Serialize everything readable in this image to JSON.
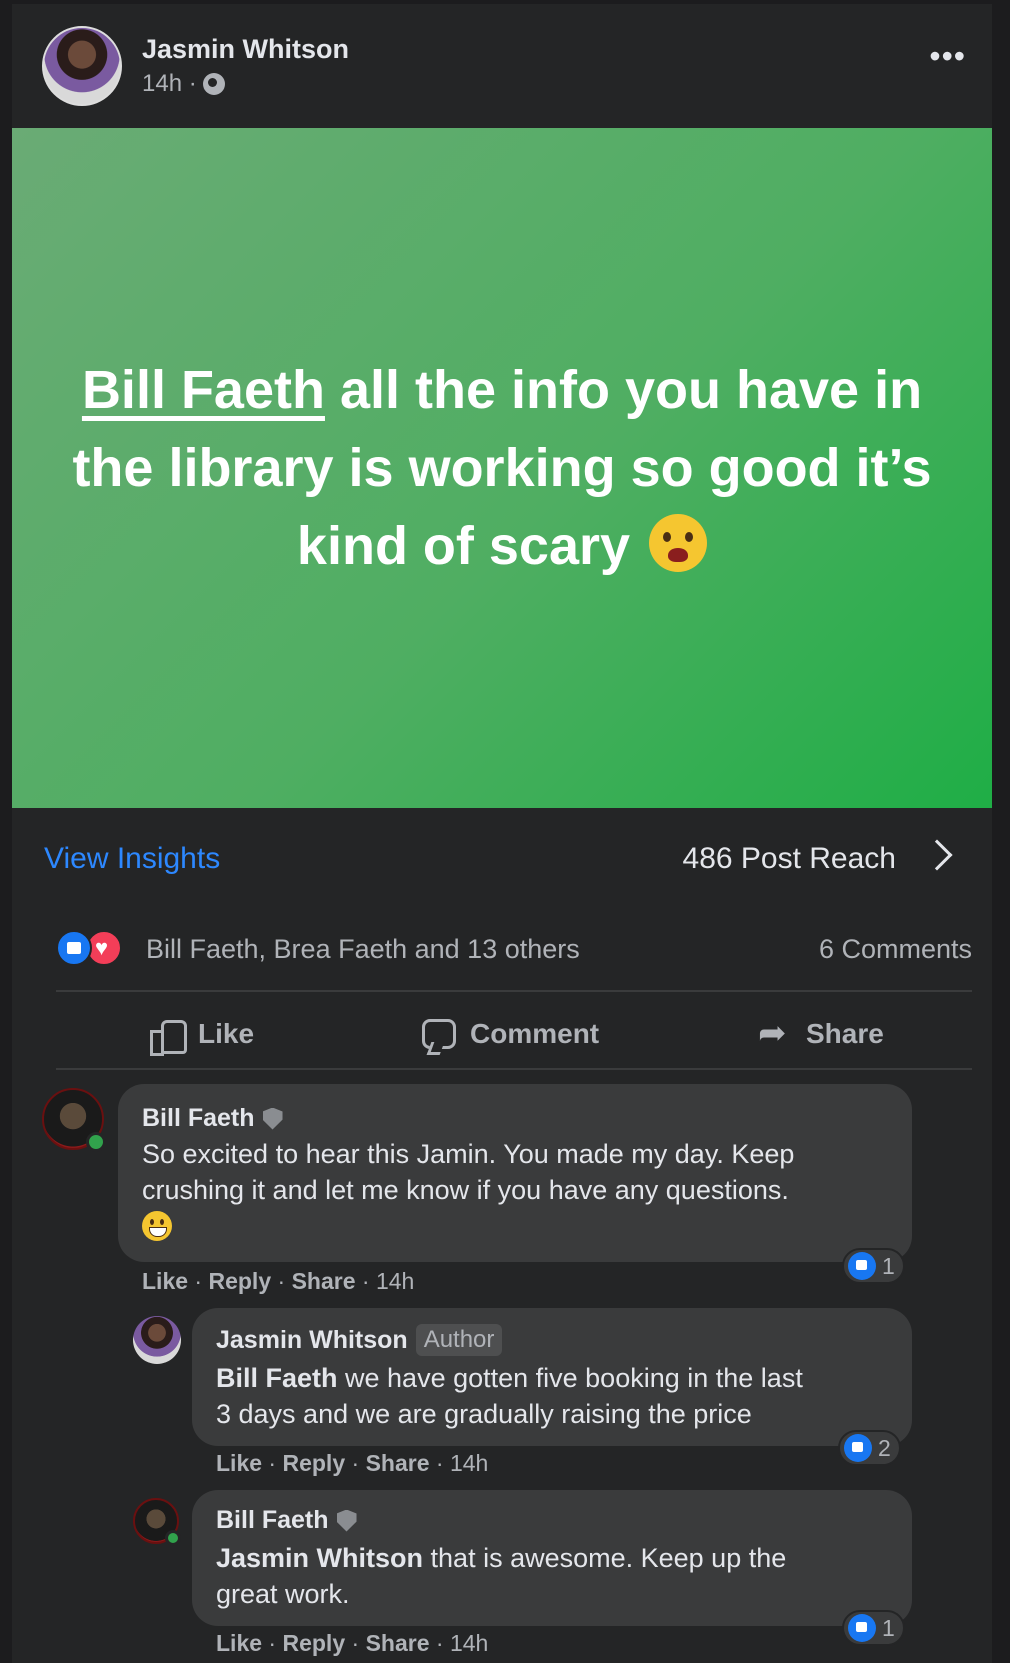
{
  "post": {
    "author": "Jasmin Whitson",
    "time": "14h ·",
    "text_mention": "Bill Faeth",
    "text_body": " all the info you have in the library is working so good it’s kind of scary "
  },
  "insights": {
    "view_label": "View Insights",
    "reach": "486 Post Reach"
  },
  "reactions": {
    "summary": "Bill Faeth, Brea Faeth and 13 others",
    "comments": "6 Comments"
  },
  "actions": {
    "like": "Like",
    "comment": "Comment",
    "share": "Share"
  },
  "comments": [
    {
      "name": "Bill Faeth",
      "line1": "So excited to hear this Jamin. You made my day. Keep",
      "line2": "crushing it and let me know if you have any questions.",
      "like": "Like",
      "reply": "Reply",
      "share": "Share",
      "time": "14h",
      "reaction_count": "1"
    },
    {
      "name": "Jasmin Whitson",
      "badge": "Author",
      "mention": "Bill Faeth",
      "line1_rest": " we have gotten five booking in the last",
      "line2": "3 days and we are gradually raising the price",
      "like": "Like",
      "reply": "Reply",
      "share": "Share",
      "time": "14h",
      "reaction_count": "2"
    },
    {
      "name": "Bill Faeth",
      "mention": "Jasmin Whitson",
      "line1_rest": " that is awesome. Keep up the",
      "line2": "great work.",
      "like": "Like",
      "reply": "Reply",
      "share": "Share",
      "time": "14h",
      "reaction_count": "1"
    }
  ],
  "colors": {
    "background": "#242526",
    "post_green": "#4fae62",
    "link_blue": "#2d88ff",
    "like_blue": "#1877f2",
    "love_red": "#f33e58"
  },
  "icons": [
    "globe-icon",
    "more-icon",
    "chevron-right-icon",
    "like-reaction-icon",
    "love-reaction-icon",
    "thumb-icon",
    "bubble-icon",
    "share-arrow-icon",
    "shield-icon",
    "mini-like-icon"
  ]
}
